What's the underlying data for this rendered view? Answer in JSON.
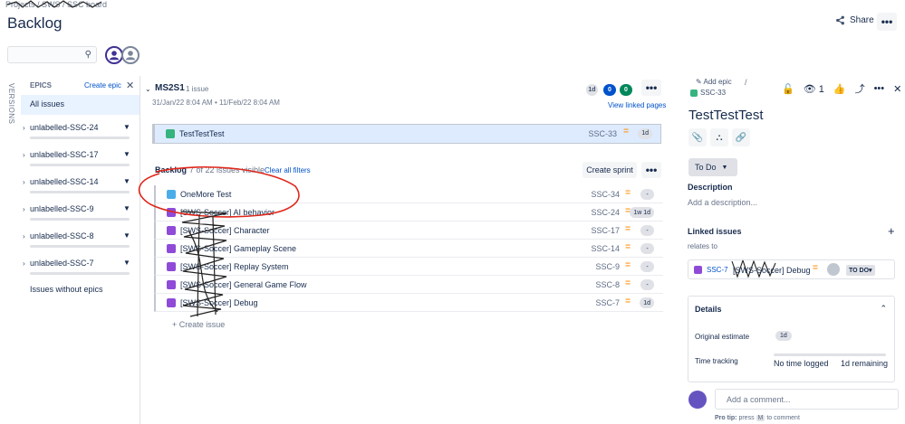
{
  "breadcrumb": "Projects / SWS / SSC board",
  "page": {
    "title": "Backlog"
  },
  "header": {
    "share_label": "Share",
    "more_label": "•••"
  },
  "search": {
    "placeholder": ""
  },
  "sidebar": {
    "versions_label": "VERSIONS",
    "epics_label": "EPICS",
    "create_epic_label": "Create epic",
    "close_label": "✕",
    "all_issues_label": "All issues",
    "epics": [
      {
        "label": "unlabelled-SSC-24"
      },
      {
        "label": "unlabelled-SSC-17"
      },
      {
        "label": "unlabelled-SSC-14"
      },
      {
        "label": "unlabelled-SSC-9"
      },
      {
        "label": "unlabelled-SSC-8"
      },
      {
        "label": "unlabelled-SSC-7"
      }
    ],
    "without_epics_label": "Issues without epics"
  },
  "sprint": {
    "name": "MS2S1",
    "count": "1 issue",
    "dates": "31/Jan/22 8:04 AM • 11/Feb/22 8:04 AM",
    "pills": [
      "1d",
      "0",
      "0"
    ],
    "view_linked": "View linked pages",
    "issue": {
      "summary": "TestTestTest",
      "key": "SSC-33",
      "priority": "=",
      "estimate": "1d"
    }
  },
  "backlog": {
    "title": "Backlog",
    "count": "7 of 22 issues visible",
    "clear_filters": "Clear all filters",
    "create_sprint_label": "Create sprint",
    "more_label": "•••",
    "issues": [
      {
        "summary": "OneMore Test",
        "key": "SSC-34",
        "priority": "=",
        "estimate": "-",
        "type": "task"
      },
      {
        "summary": "[SWS-Soccer] AI behavior",
        "key": "SSC-24",
        "priority": "=",
        "estimate": "1w 1d",
        "type": "epic"
      },
      {
        "summary": "[SWS-Soccer] Character",
        "key": "SSC-17",
        "priority": "=",
        "estimate": "-",
        "type": "epic"
      },
      {
        "summary": "[SWS-Soccer] Gameplay Scene",
        "key": "SSC-14",
        "priority": "=",
        "estimate": "-",
        "type": "epic"
      },
      {
        "summary": "[SWS-Soccer] Replay System",
        "key": "SSC-9",
        "priority": "=",
        "estimate": "-",
        "type": "epic"
      },
      {
        "summary": "[SWS-Soccer] General Game Flow",
        "key": "SSC-8",
        "priority": "=",
        "estimate": "-",
        "type": "epic"
      },
      {
        "summary": "[SWS-Soccer] Debug",
        "key": "SSC-7",
        "priority": "=",
        "estimate": "1d",
        "type": "epic"
      }
    ],
    "create_issue_label": "+ Create issue"
  },
  "detail": {
    "add_epic": "Add epic",
    "slash": "/",
    "key": "SSC-33",
    "watch_count": "1",
    "title": "TestTestTest",
    "status": "To Do",
    "description_label": "Description",
    "description_placeholder": "Add a description...",
    "linked_label": "Linked issues",
    "relates_to": "relates to",
    "linked_issue": {
      "key": "SSC-7",
      "summary": "[SWS-Soccer] Debug",
      "status": "TO DO"
    },
    "details_label": "Details",
    "original_estimate_label": "Original estimate",
    "original_estimate": "1d",
    "time_tracking_label": "Time tracking",
    "time_logged": "No time logged",
    "time_remaining": "1d remaining",
    "comment_placeholder": "Add a comment...",
    "tip_prefix": "Pro tip:",
    "tip_press": "press",
    "tip_key": "M",
    "tip_suffix": "to comment"
  },
  "colors": {
    "accent": "#0052cc",
    "story": "#36b37e",
    "task": "#4bade8",
    "epic": "#8f4bd7",
    "priority": "#ff991f",
    "annotation": "#e0271a"
  }
}
